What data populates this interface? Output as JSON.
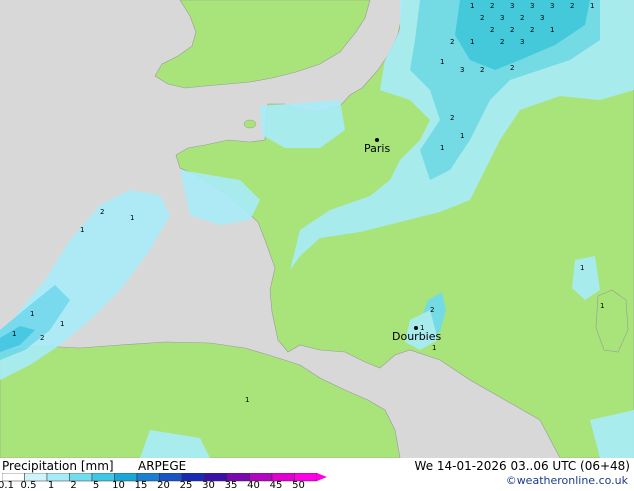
{
  "map": {
    "cities": [
      {
        "name": "Paris"
      },
      {
        "name": "Dourbies"
      }
    ]
  },
  "footer": {
    "title": "Precipitation [mm]",
    "model": "ARPEGE",
    "valid_time": "We 14-01-2026 03..06 UTC (06+48)",
    "credit": "©weatheronline.co.uk",
    "scale": [
      {
        "label": "0.1",
        "color": "#ffffff"
      },
      {
        "label": "0.5",
        "color": "#cff4fb"
      },
      {
        "label": "1",
        "color": "#a6ebf7"
      },
      {
        "label": "2",
        "color": "#74dcef"
      },
      {
        "label": "5",
        "color": "#3fc8e4"
      },
      {
        "label": "10",
        "color": "#1aa6d6"
      },
      {
        "label": "15",
        "color": "#1a7fd0"
      },
      {
        "label": "20",
        "color": "#1b53c4"
      },
      {
        "label": "25",
        "color": "#1a2ab5"
      },
      {
        "label": "30",
        "color": "#3a10a8"
      },
      {
        "label": "35",
        "color": "#7a08b0"
      },
      {
        "label": "40",
        "color": "#b206c0"
      },
      {
        "label": "45",
        "color": "#e000d0"
      },
      {
        "label": "50",
        "color": "#ff00e6"
      }
    ]
  },
  "colors": {
    "land": "#a8e47a",
    "sea": "#d8d8d8",
    "precip_light": "#a9ecf9",
    "precip_mid": "#6fdaf0",
    "precip_heavy": "#3ac7e6"
  }
}
